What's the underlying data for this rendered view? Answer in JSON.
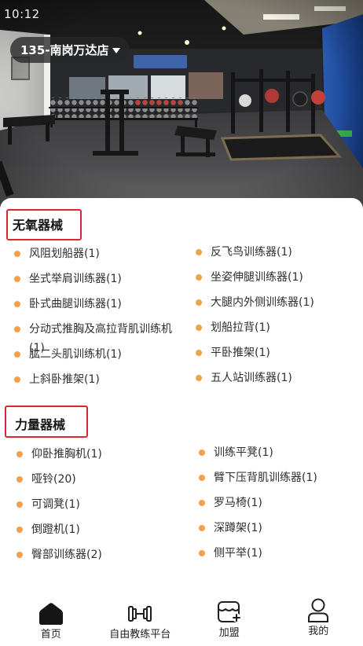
{
  "status_bar": {
    "time": "10:12"
  },
  "store_selector": {
    "label": "135-南岗万达店",
    "icon": "caret-down-icon"
  },
  "sections": [
    {
      "title": "无氧器械",
      "items": [
        "风阻划船器(1)",
        "反飞鸟训练器(1)",
        "坐式举肩训练器(1)",
        "坐姿伸腿训练器(1)",
        "卧式曲腿训练器(1)",
        "大腿内外侧训练器(1)",
        "分动式推胸及高拉背肌训练机(1)",
        "划船拉背(1)",
        "肱二头肌训练机(1)",
        "平卧推架(1)",
        "上斜卧推架(1)",
        "五人站训练器(1)"
      ]
    },
    {
      "title": "力量器械",
      "items": [
        "仰卧推胸机(1)",
        "训练平凳(1)",
        "哑铃(20)",
        "臂下压背肌训练器(1)",
        "可调凳(1)",
        "罗马椅(1)",
        "倒蹬机(1)",
        "深蹲架(1)",
        "臀部训练器(2)",
        "侧平举(1)"
      ]
    }
  ],
  "tab_bar": {
    "tabs": [
      {
        "label": "首页",
        "icon": "home-icon",
        "active": true
      },
      {
        "label": "自由教练平台",
        "icon": "dumbbell-icon",
        "active": false
      },
      {
        "label": "加盟",
        "icon": "store-plus-icon",
        "active": false
      },
      {
        "label": "我的",
        "icon": "user-icon",
        "active": false
      }
    ]
  },
  "colors": {
    "bullet": "#f4a04a",
    "highlight_box": "#e0262c",
    "active_tab_icon": "#151515"
  }
}
